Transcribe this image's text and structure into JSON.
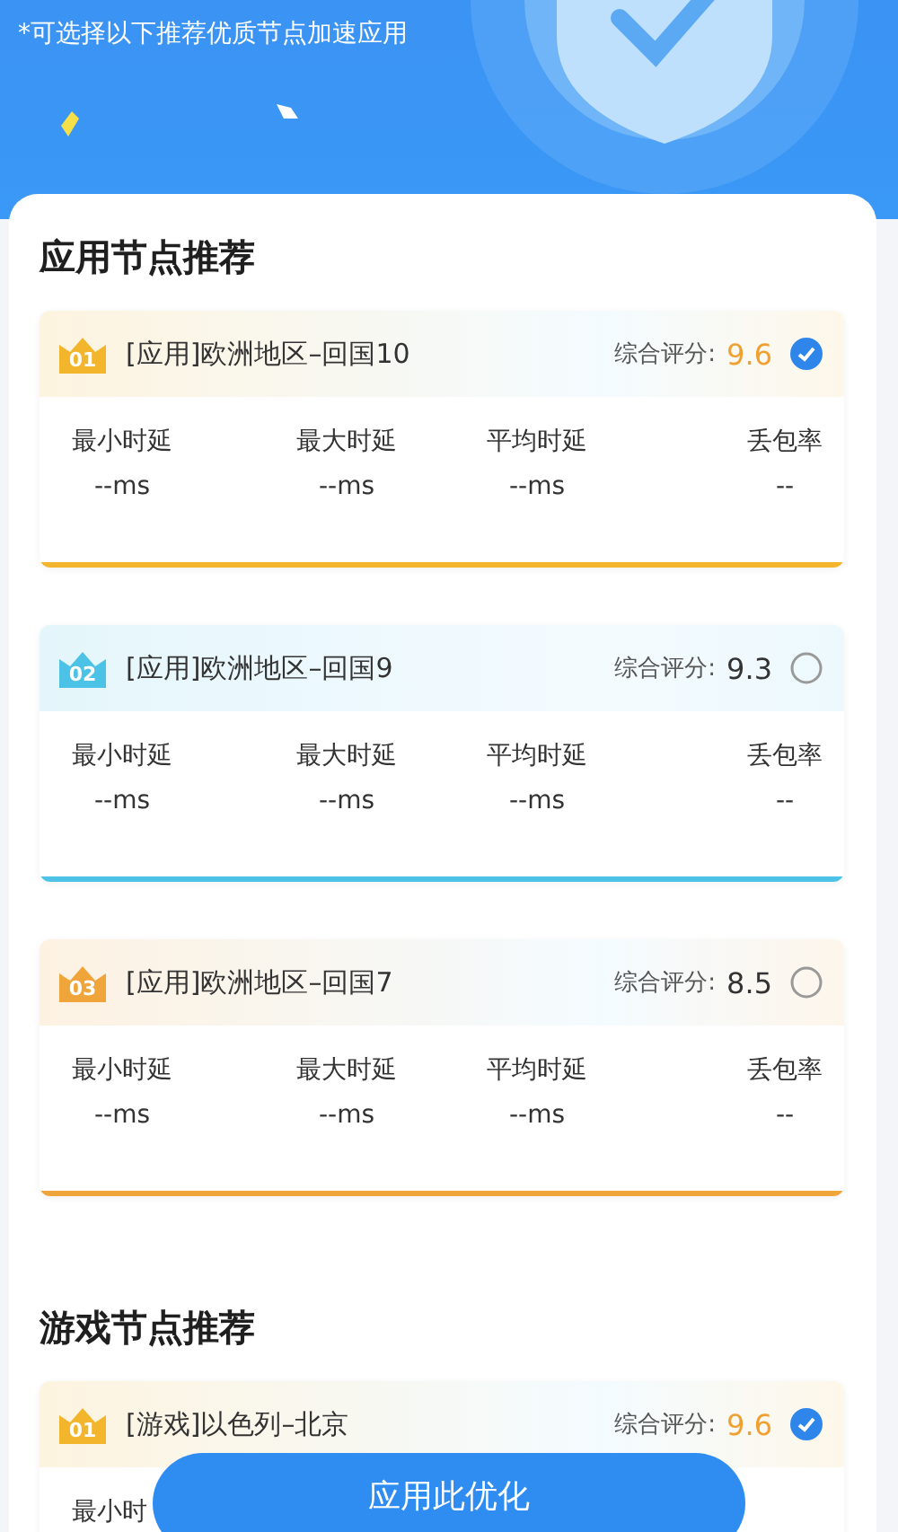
{
  "header": {
    "note": "*可选择以下推荐优质节点加速应用"
  },
  "sections": [
    {
      "title": "应用节点推荐",
      "nodes": [
        {
          "rank": "01",
          "name": "[应用]欧洲地区–回国10",
          "score_label": "综合评分:",
          "score": "9.6",
          "selected": true,
          "color": "#f2b52c",
          "metrics": [
            {
              "label": "最小时延",
              "value": "--ms"
            },
            {
              "label": "最大时延",
              "value": "--ms"
            },
            {
              "label": "平均时延",
              "value": "--ms"
            },
            {
              "label": "丢包率",
              "value": "--"
            }
          ]
        },
        {
          "rank": "02",
          "name": "[应用]欧洲地区–回国9",
          "score_label": "综合评分:",
          "score": "9.3",
          "selected": false,
          "color": "#4cc3e6",
          "metrics": [
            {
              "label": "最小时延",
              "value": "--ms"
            },
            {
              "label": "最大时延",
              "value": "--ms"
            },
            {
              "label": "平均时延",
              "value": "--ms"
            },
            {
              "label": "丢包率",
              "value": "--"
            }
          ]
        },
        {
          "rank": "03",
          "name": "[应用]欧洲地区–回国7",
          "score_label": "综合评分:",
          "score": "8.5",
          "selected": false,
          "color": "#f0a53a",
          "metrics": [
            {
              "label": "最小时延",
              "value": "--ms"
            },
            {
              "label": "最大时延",
              "value": "--ms"
            },
            {
              "label": "平均时延",
              "value": "--ms"
            },
            {
              "label": "丢包率",
              "value": "--"
            }
          ]
        }
      ]
    },
    {
      "title": "游戏节点推荐",
      "nodes": [
        {
          "rank": "01",
          "name": "[游戏]以色列–北京",
          "score_label": "综合评分:",
          "score": "9.6",
          "selected": true,
          "color": "#f2b52c",
          "metrics": [
            {
              "label": "最小时"
            }
          ]
        }
      ]
    }
  ],
  "apply_button": {
    "label": "应用此优化"
  }
}
